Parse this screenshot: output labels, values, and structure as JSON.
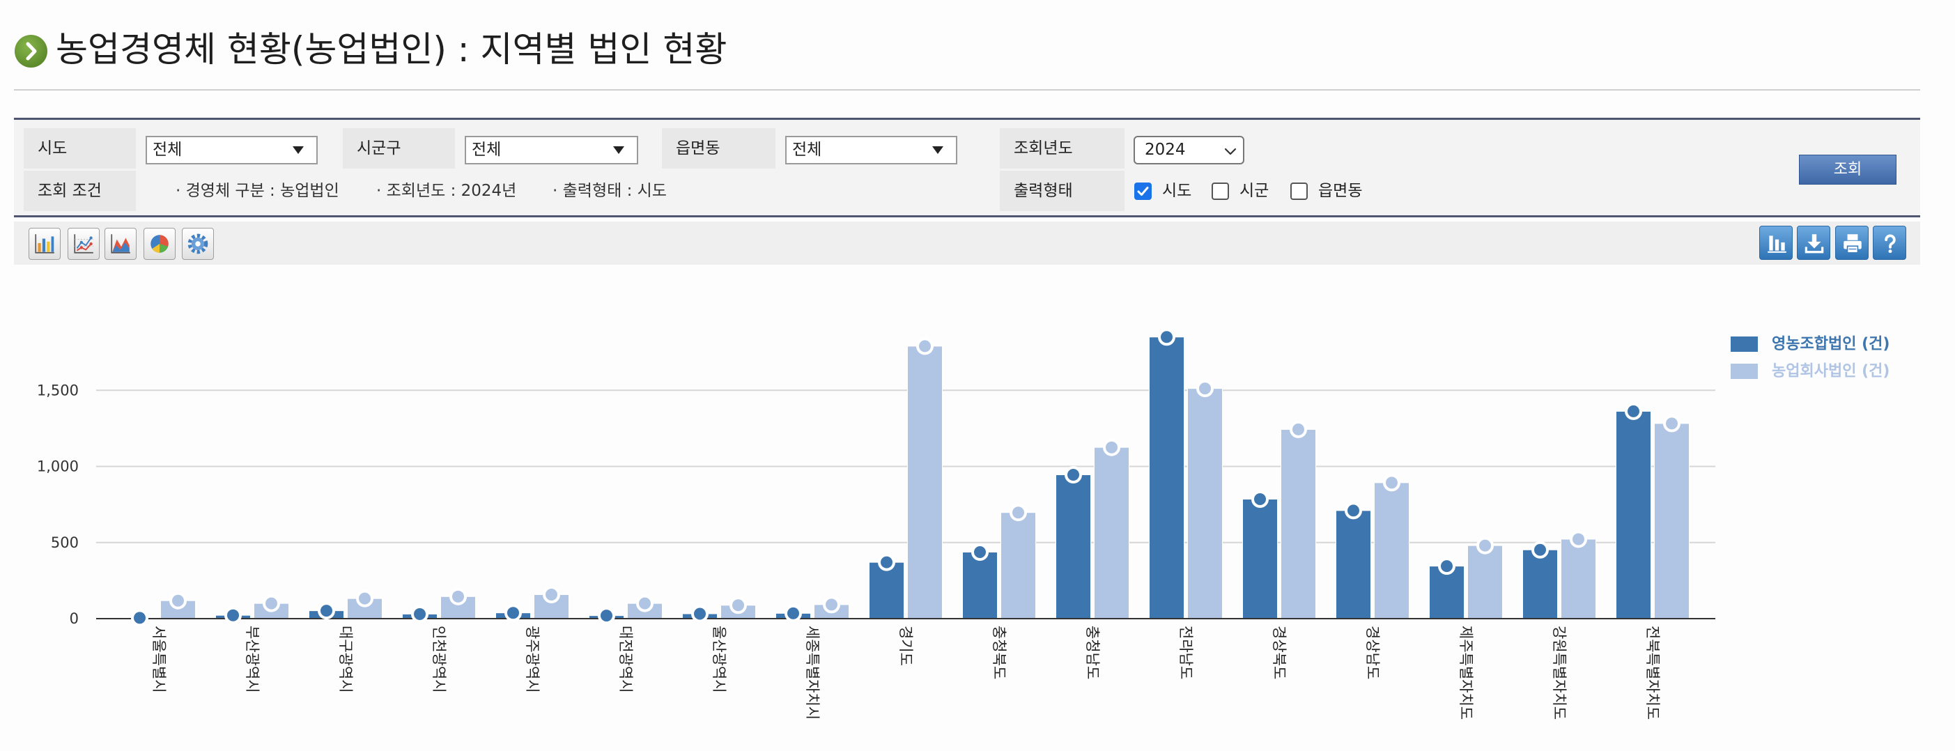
{
  "page": {
    "title": "농업경영체 현황(농업법인) : 지역별 법인 현황",
    "title_icon": "chevron-right-circle-icon"
  },
  "filters": {
    "sido": {
      "label": "시도",
      "value": "전체"
    },
    "sigungu": {
      "label": "시군구",
      "value": "전체"
    },
    "eupmyeondong": {
      "label": "읍면동",
      "value": "전체"
    },
    "year": {
      "label": "조회년도",
      "value": "2024"
    },
    "conditions": {
      "label": "조회 조건",
      "items": [
        "· 경영체 구분 : 농업법인",
        "· 조회년도 : 2024년",
        "· 출력형태 : 시도"
      ]
    },
    "output_type": {
      "label": "출력형태",
      "options": [
        {
          "label": "시도",
          "checked": true
        },
        {
          "label": "시군",
          "checked": false
        },
        {
          "label": "읍면동",
          "checked": false
        }
      ]
    },
    "search_button": "조회"
  },
  "toolbar": {
    "left_icons": [
      "bar-chart-icon",
      "line-chart-icon",
      "area-chart-icon",
      "pie-chart-icon",
      "settings-icon"
    ],
    "right_icons": [
      "bar-chart-icon",
      "download-icon",
      "print-icon",
      "help-icon"
    ]
  },
  "colors": {
    "accent": "#3d76ae",
    "panel_border": "#4f5470",
    "search_button": "#4a73b0",
    "title_icon": "#5f8f2b",
    "checkbox_checked": "#1a73e8"
  },
  "chart_data": {
    "type": "bar",
    "categories": [
      "서울특별시",
      "부산광역시",
      "대구광역시",
      "인천광역시",
      "광주광역시",
      "대전광역시",
      "울산광역시",
      "세종특별자치시",
      "경기도",
      "충청북도",
      "충청남도",
      "전라남도",
      "경상북도",
      "경상남도",
      "제주특별자치도",
      "강원특별자치도",
      "전북특별자치도"
    ],
    "series": [
      {
        "name": "영농조합법인 (건)",
        "color": "#3d76ae",
        "values": [
          5,
          22,
          52,
          30,
          38,
          20,
          32,
          35,
          370,
          437,
          945,
          1850,
          785,
          710,
          345,
          452,
          1362
        ]
      },
      {
        "name": "농업회사법인 (건)",
        "color": "#b0c4e4",
        "values": [
          118,
          100,
          132,
          145,
          158,
          100,
          88,
          92,
          1790,
          697,
          1125,
          1512,
          1243,
          893,
          480,
          522,
          1282
        ]
      }
    ],
    "yticks": [
      0,
      500,
      1000,
      1500
    ],
    "ytick_labels": [
      "0",
      "500",
      "1,000",
      "1,500"
    ],
    "ylim": [
      0,
      2000
    ],
    "grid": true,
    "legend": "top-right"
  }
}
